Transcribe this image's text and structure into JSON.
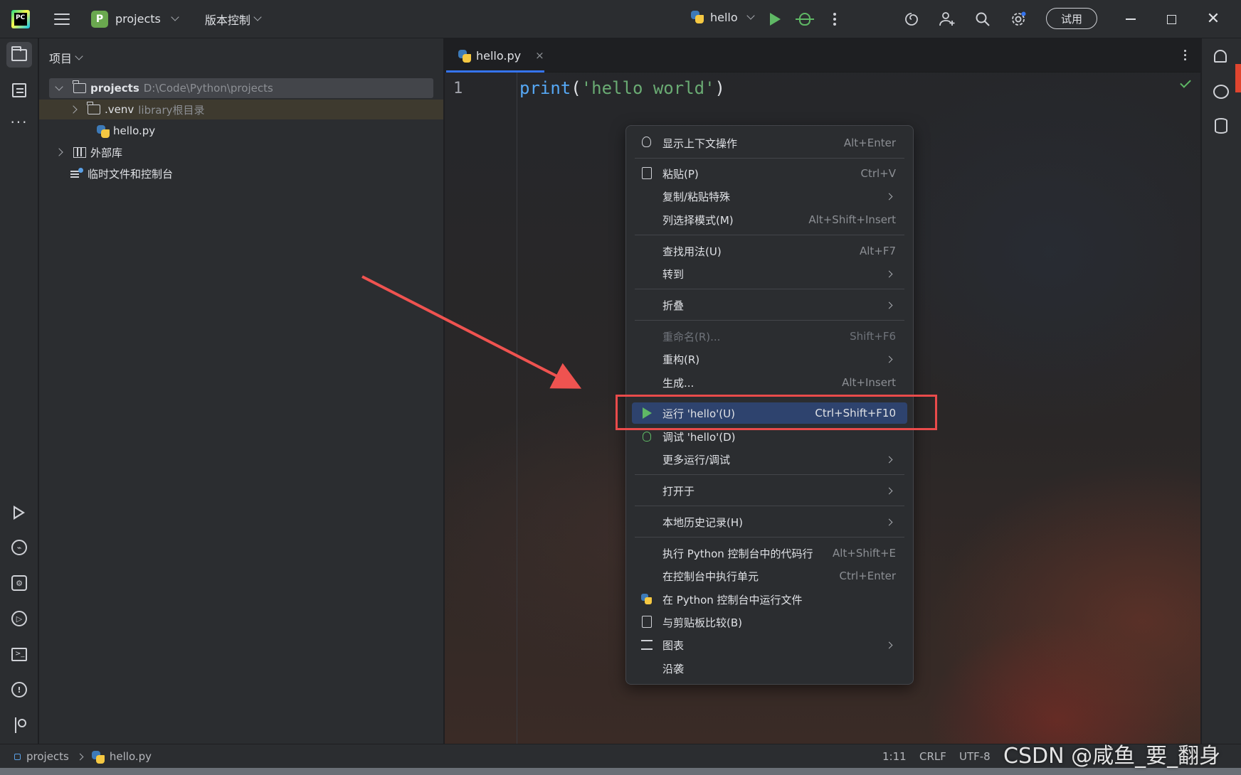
{
  "titlebar": {
    "logo_text": "PC",
    "project_badge": "P",
    "project_name": "projects",
    "vcs_label": "版本控制",
    "run_config": "hello",
    "trial_label": "试用"
  },
  "project_panel": {
    "title": "项目",
    "tree": [
      {
        "label": "projects",
        "hint": "D:\\Code\\Python\\projects"
      },
      {
        "label": ".venv",
        "hint": "library根目录"
      },
      {
        "label": "hello.py",
        "hint": ""
      },
      {
        "label": "外部库",
        "hint": ""
      },
      {
        "label": "临时文件和控制台",
        "hint": ""
      }
    ]
  },
  "editor": {
    "tab_label": "hello.py",
    "tab_close": "×",
    "line_number": "1",
    "code": {
      "fn": "print",
      "open": "(",
      "str": "'hello world'",
      "close": ")"
    }
  },
  "context_menu": {
    "items": [
      {
        "label": "显示上下文操作",
        "shortcut": "Alt+Enter"
      },
      {
        "label": "粘贴(P)",
        "shortcut": "Ctrl+V"
      },
      {
        "label": "复制/粘贴特殊",
        "shortcut": ""
      },
      {
        "label": "列选择模式(M)",
        "shortcut": "Alt+Shift+Insert"
      },
      {
        "label": "查找用法(U)",
        "shortcut": "Alt+F7"
      },
      {
        "label": "转到",
        "shortcut": ""
      },
      {
        "label": "折叠",
        "shortcut": ""
      },
      {
        "label": "重命名(R)...",
        "shortcut": "Shift+F6"
      },
      {
        "label": "重构(R)",
        "shortcut": ""
      },
      {
        "label": "生成...",
        "shortcut": "Alt+Insert"
      },
      {
        "label": "运行 'hello'(U)",
        "shortcut": "Ctrl+Shift+F10"
      },
      {
        "label": "调试 'hello'(D)",
        "shortcut": ""
      },
      {
        "label": "更多运行/调试",
        "shortcut": ""
      },
      {
        "label": "打开于",
        "shortcut": ""
      },
      {
        "label": "本地历史记录(H)",
        "shortcut": ""
      },
      {
        "label": "执行 Python 控制台中的代码行",
        "shortcut": "Alt+Shift+E"
      },
      {
        "label": "在控制台中执行单元",
        "shortcut": "Ctrl+Enter"
      },
      {
        "label": "在 Python 控制台中运行文件",
        "shortcut": ""
      },
      {
        "label": "与剪贴板比较(B)",
        "shortcut": ""
      },
      {
        "label": "图表",
        "shortcut": ""
      },
      {
        "label": "沿袭",
        "shortcut": ""
      }
    ]
  },
  "statusbar": {
    "crumb_project": "projects",
    "crumb_file": "hello.py",
    "position": "1:11",
    "line_sep": "CRLF",
    "encoding": "UTF-8"
  },
  "watermark": "CSDN @咸鱼_要_翻身",
  "colors": {
    "accent": "#3574f0",
    "highlight_box": "#e94b4b",
    "run_green": "#5fb865",
    "menu_selected": "#2e436e"
  }
}
